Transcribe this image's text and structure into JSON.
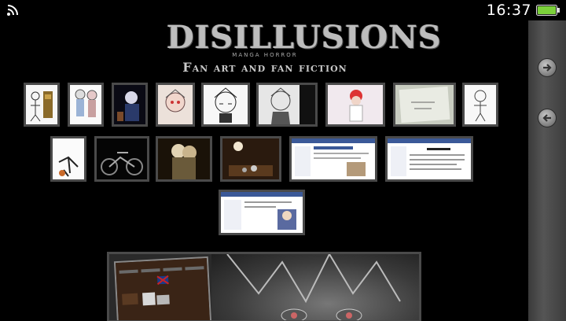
{
  "status_bar": {
    "time": "16:37",
    "icons": {
      "wifi": "wifi-icon",
      "battery": "battery-icon"
    },
    "battery_color": "#7cd13a"
  },
  "logo": {
    "title": "DISILLUSIONS",
    "subtitle": "MANGA HORROR",
    "tagline": "Fan art and fan fiction"
  },
  "side_rail": {
    "buttons": [
      {
        "icon": "arrow-right-icon"
      },
      {
        "icon": "arrow-left-icon"
      }
    ]
  },
  "gallery": {
    "rows": [
      {
        "items": [
          "sketch-figures",
          "sketch-pair",
          "dark-character",
          "sketch-face",
          "sketch-face-2",
          "pencil-portrait",
          "red-hair-character",
          "paper-drawing",
          "sketch-figure"
        ]
      },
      {
        "items": [
          "skeleton-sketch",
          "motorcycle",
          "two-figures-dark",
          "dark-room",
          "forum-screenshot",
          "forum-screenshot-2"
        ]
      },
      {
        "items": [
          "forum-screenshot-3"
        ]
      }
    ]
  },
  "preview": {
    "left_panel": "site-menu-screenshot",
    "right_panel": "character-closeup"
  },
  "colors": {
    "background": "#000000",
    "thumb_border": "#4a4a4a",
    "rail": "#4a4a4a",
    "logo_text": "#bdbdbd"
  }
}
